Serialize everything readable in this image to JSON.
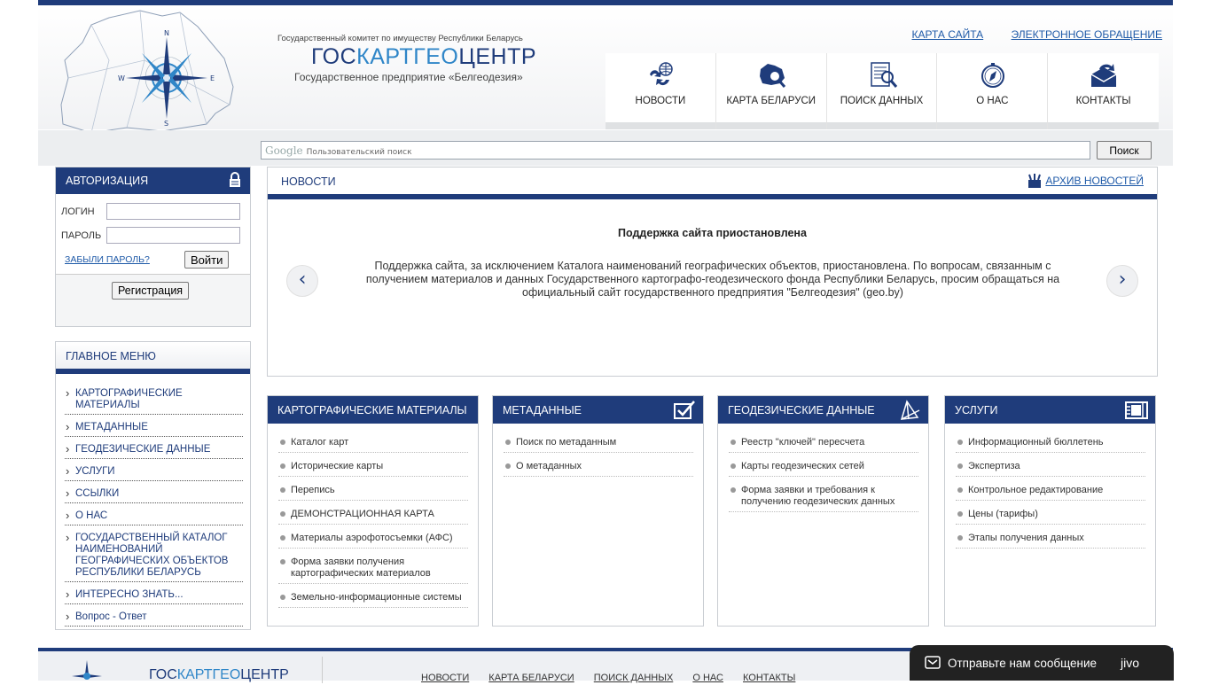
{
  "header": {
    "org_line": "Государственный комитет по имуществу Республики Беларусь",
    "brand_a": "ГОС",
    "brand_b": "КАРТГЕО",
    "brand_c": "ЦЕНТР",
    "org_sub": "Государственное предприятие «Белгеодезия»",
    "links": {
      "sitemap": "КАРТА САЙТА",
      "appeal": "ЭЛЕКТРОННОЕ ОБРАЩЕНИЕ"
    },
    "nav": [
      {
        "label": "НОВОСТИ",
        "icon": "news-icon"
      },
      {
        "label": "КАРТА БЕЛАРУСИ",
        "icon": "belarus-map-icon"
      },
      {
        "label": "ПОИСК ДАННЫХ",
        "icon": "data-search-icon"
      },
      {
        "label": "О НАС",
        "icon": "compass-icon"
      },
      {
        "label": "КОНТАКТЫ",
        "icon": "mail-icon"
      }
    ]
  },
  "search": {
    "logo": "Google",
    "placeholder": "Пользовательский поиск",
    "button": "Поиск"
  },
  "auth": {
    "title": "АВТОРИЗАЦИЯ",
    "login_label": "ЛОГИН",
    "password_label": "ПАРОЛЬ",
    "forgot": "ЗАБЫЛИ ПАРОЛЬ?",
    "login_button": "Войти",
    "register_button": "Регистрация"
  },
  "main_menu": {
    "title": "ГЛАВНОЕ МЕНЮ",
    "items": [
      "КАРТОГРАФИЧЕСКИЕ МАТЕРИАЛЫ",
      "МЕТАДАННЫЕ",
      "ГЕОДЕЗИЧЕСКИЕ ДАННЫЕ",
      "УСЛУГИ",
      "ССЫЛКИ",
      "О НАС",
      "ГОСУДАРСТВЕННЫЙ КАТАЛОГ НАИМЕНОВАНИЙ ГЕОГРАФИЧЕСКИХ ОБЪЕКТОВ РЕСПУБЛИКИ БЕЛАРУСЬ",
      "ИНТЕРЕСНО ЗНАТЬ...",
      "Вопрос - Ответ"
    ]
  },
  "news": {
    "title": "НОВОСТИ",
    "archive": "АРХИВ НОВОСТЕЙ",
    "headline": "Поддержка сайта приостановлена",
    "text": "Поддержка сайта, за исключением Каталога наименований географических объектов, приостановлена. По вопросам, связанным с получением материалов и данных Государственного картографо-геодезического фонда Республики Беларусь, просим обращаться на официальный сайт государственного предприятия \"Белгеодезия\" (geo.by)",
    "prev": "‹",
    "next": "›"
  },
  "cards": [
    {
      "title": "КАРТОГРАФИЧЕСКИЕ МАТЕРИАЛЫ",
      "icon": "",
      "items": [
        "Каталог карт",
        "Исторические карты",
        "Перепись",
        "ДЕМОНСТРАЦИОННАЯ КАРТА",
        "Материалы аэрофотосъемки (АФС)",
        "Форма заявки получения картографических материалов",
        "Земельно-информационные системы"
      ]
    },
    {
      "title": "МЕТАДАННЫЕ",
      "icon": "checkbox-icon",
      "items": [
        "Поиск по метаданным",
        "О метаданных"
      ]
    },
    {
      "title": "ГЕОДЕЗИЧЕСКИЕ ДАННЫЕ",
      "icon": "geodesy-icon",
      "items": [
        "Реестр \"ключей\" пересчета",
        "Карты геодезических сетей",
        "Форма заявки и требования к получению геодезических данных"
      ]
    },
    {
      "title": "УСЛУГИ",
      "icon": "ticket-icon",
      "items": [
        "Информационный бюллетень",
        "Экспертиза",
        "Контрольное редактирование",
        "Цены (тарифы)",
        "Этапы получения данных"
      ]
    }
  ],
  "footer": {
    "brand_a": "ГОС",
    "brand_b": "КАРТГЕО",
    "brand_c": "ЦЕНТР",
    "nav": [
      "НОВОСТИ",
      "КАРТА БЕЛАРУСИ",
      "ПОИСК ДАННЫХ",
      "О НАС",
      "КОНТАКТЫ"
    ]
  },
  "chat": {
    "label": "Отправьте нам сообщение",
    "brand": "jivo"
  },
  "colors": {
    "primary": "#1f3c7b",
    "link": "#1f5aa8",
    "accent": "#2f86c8"
  }
}
